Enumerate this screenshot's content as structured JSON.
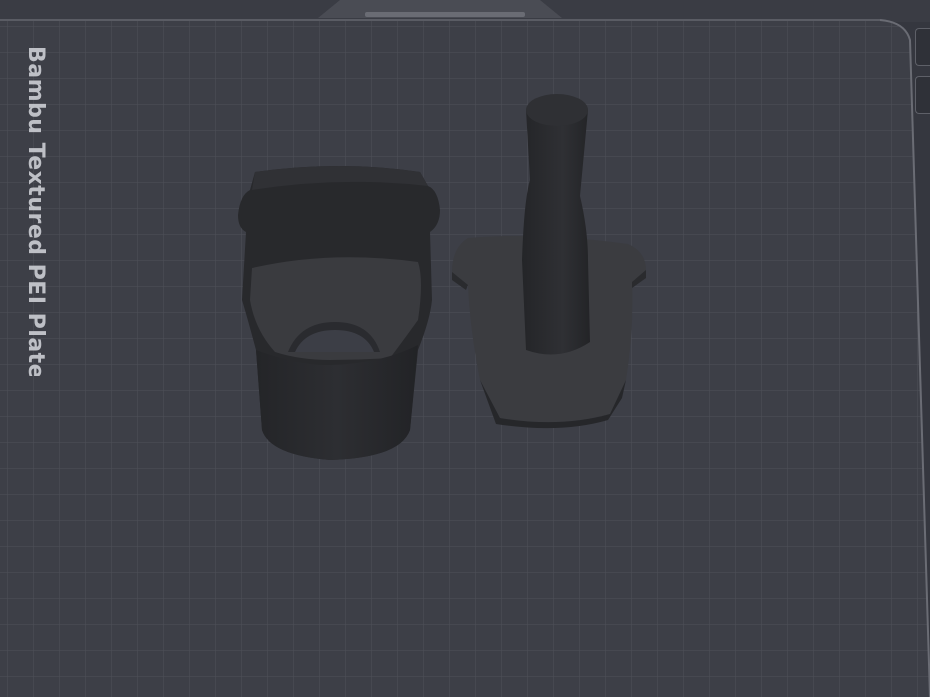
{
  "plate": {
    "name": "Bambu Textured PEI Plate"
  },
  "colors": {
    "background": "#35373f",
    "plate": "#3c3e46",
    "grid": "#4e5058",
    "model": "#2a2b2f"
  },
  "viewport": {
    "side_buttons": [
      "plate-toggle-1-icon",
      "plate-toggle-2-icon"
    ]
  }
}
